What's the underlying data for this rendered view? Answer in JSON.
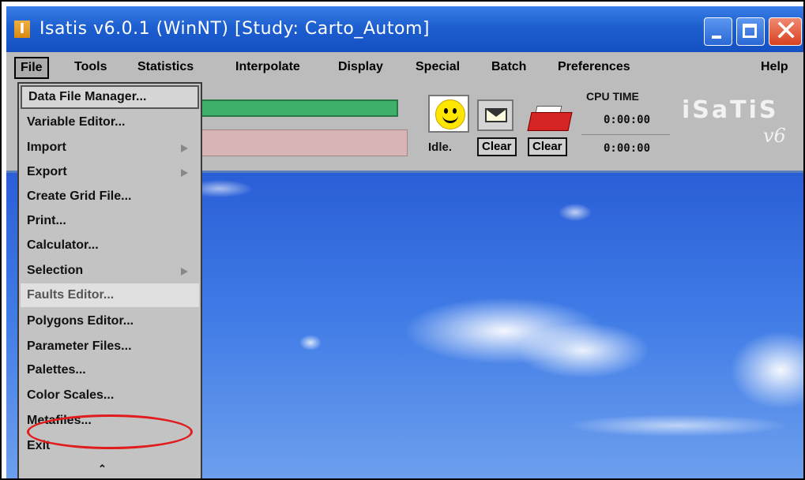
{
  "window": {
    "title": "Isatis v6.0.1 (WinNT) [Study: Carto_Autom]",
    "app_icon_letter": "I"
  },
  "menubar": {
    "file": "File",
    "tools": "Tools",
    "statistics": "Statistics",
    "interpolate": "Interpolate",
    "display": "Display",
    "special": "Special",
    "batch": "Batch",
    "preferences": "Preferences",
    "help": "Help"
  },
  "toolbar": {
    "status": "Idle.",
    "clear1": "Clear",
    "clear2": "Clear",
    "cpu_time_label": "CPU TIME",
    "cpu_time_1": "0:00:00",
    "cpu_time_2": "0:00:00",
    "logo": "iSaTiS",
    "logo_version": "v6",
    "icons": [
      "smiley-face-icon",
      "envelope-icon",
      "tray-icon"
    ]
  },
  "file_menu": {
    "items": [
      {
        "label": "Data File Manager..."
      },
      {
        "label": "Variable Editor..."
      },
      {
        "label": "Import",
        "submenu": true
      },
      {
        "label": "Export",
        "submenu": true
      },
      {
        "label": "Create Grid File..."
      },
      {
        "label": "Print..."
      },
      {
        "label": "Calculator..."
      },
      {
        "label": "Selection",
        "submenu": true
      },
      {
        "label": "Faults Editor..."
      },
      {
        "label": "Polygons Editor..."
      },
      {
        "label": "Parameter Files..."
      },
      {
        "label": "Palettes..."
      },
      {
        "label": "Color Scales..."
      },
      {
        "label": "Metafiles..."
      },
      {
        "label": "Exit"
      }
    ],
    "highlighted_item": "Faults Editor...",
    "annotated_item": "Parameter Files...",
    "annotation_color": "#e01c1c"
  },
  "colors": {
    "titlebar": "#1d5fd0",
    "menubar": "#bcbcbc",
    "progress": "#3fb06a",
    "field": "#d8b4b4"
  }
}
